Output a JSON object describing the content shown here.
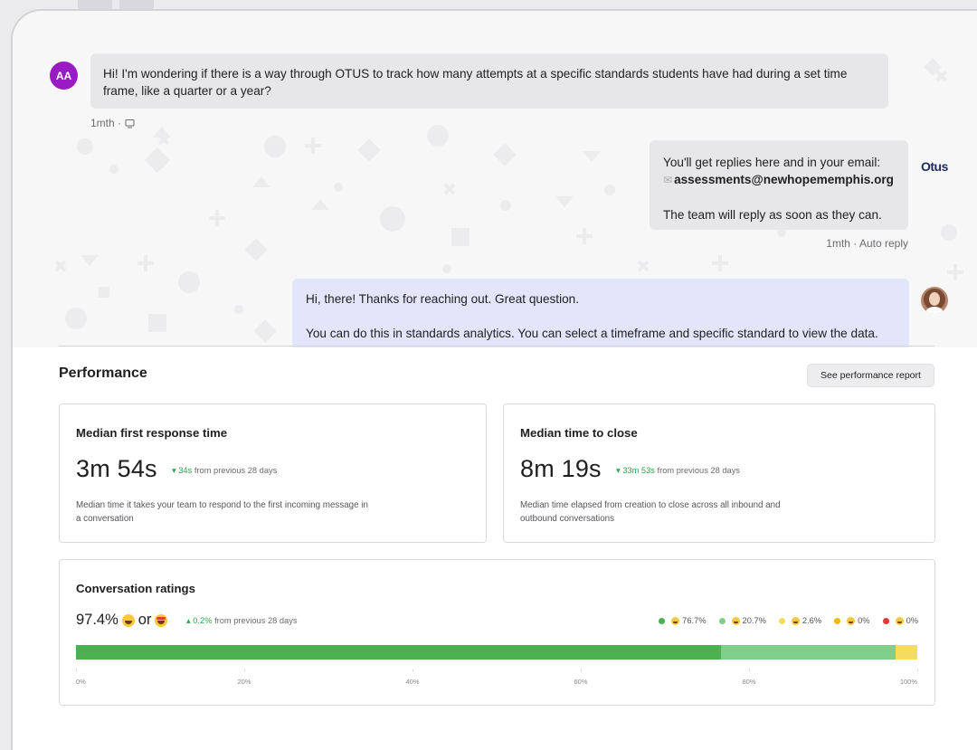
{
  "chat": {
    "incoming": {
      "avatar_initials": "AA",
      "text": "Hi! I'm wondering if there is a way through OTUS to track how many attempts at a specific standards students have had during a set time frame, like a quarter or a year?",
      "meta": "1mth ·",
      "meta_icon": "message-icon"
    },
    "auto_reply": {
      "line1": "You'll get replies here and in your email:",
      "email": "assessments@newhopememphis.org",
      "line2": "The team will reply as soon as they can.",
      "meta": "1mth · Auto reply",
      "logo_text": "Otus"
    },
    "agent_reply": {
      "line1": "Hi, there! Thanks for reaching out. Great question.",
      "line2": "You can do this in standards analytics. You can select a timeframe and specific standard to view the data."
    }
  },
  "performance": {
    "title": "Performance",
    "report_button": "See performance report",
    "first_response": {
      "title": "Median first response time",
      "value": "3m 54s",
      "delta_value": "34s",
      "delta_text": "from previous 28 days",
      "description": "Median time it takes your team to respond to the first incoming message in a conversation"
    },
    "time_to_close": {
      "title": "Median time to close",
      "value": "8m 19s",
      "delta_value": "33m 53s",
      "delta_text": "from previous 28 days",
      "description": "Median time elapsed from creation to close across all inbound and outbound conversations"
    },
    "ratings": {
      "title": "Conversation ratings",
      "value": "97.4%",
      "or_text": "or",
      "delta_value": "0.2%",
      "delta_text": "from previous 28 days",
      "legend": [
        {
          "pct": "76.7%",
          "color": "#4caf50",
          "share": 76.7
        },
        {
          "pct": "20.7%",
          "color": "#7fcf8a",
          "share": 20.7
        },
        {
          "pct": "2.6%",
          "color": "#f5dc5c",
          "share": 2.6
        },
        {
          "pct": "0%",
          "color": "#f0b800",
          "share": 0
        },
        {
          "pct": "0%",
          "color": "#e53935",
          "share": 0
        }
      ],
      "ticks": [
        "0%",
        "20%",
        "40%",
        "60%",
        "80%",
        "100%"
      ]
    }
  }
}
